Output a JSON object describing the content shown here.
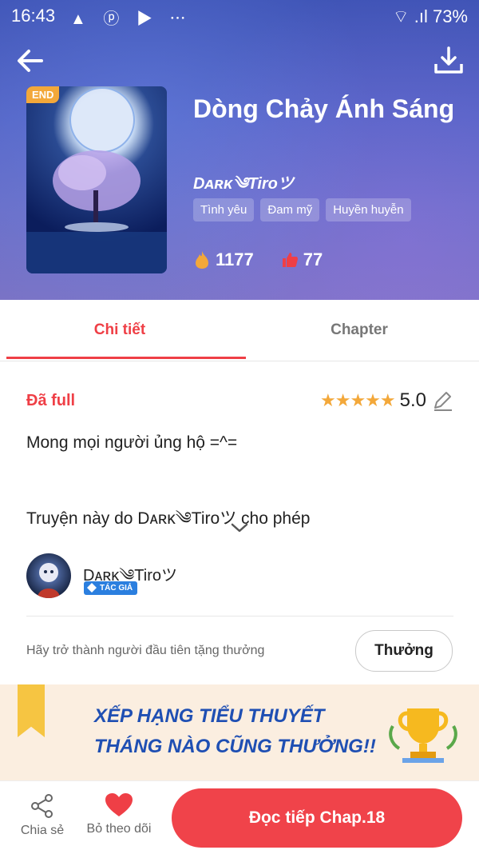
{
  "status_bar": {
    "time": "16:43",
    "notifications": "▲ ⓟ ▶ ⋯",
    "signal": "⌔ .ıl",
    "battery": "73%"
  },
  "book": {
    "badge": "END",
    "title": "Dòng Chảy Ánh Sáng",
    "author": "Dᴀʀᴋ༄Tiroツ",
    "tags": [
      "Tình yêu",
      "Đam mỹ",
      "Huyền huyễn"
    ],
    "views": "1177",
    "likes": "77"
  },
  "tabs": [
    {
      "label": "Chi tiết",
      "active": true
    },
    {
      "label": "Chapter",
      "active": false
    }
  ],
  "details": {
    "status": "Đã full",
    "stars": "★★★★★",
    "rating": "5.0",
    "description_line1": "Mong mọi người ủng hộ =^=",
    "description_line2": "Truyện này do Dᴀʀᴋ༄Tiroツ cho phép"
  },
  "author_card": {
    "name": "Dᴀʀᴋ༄Tiroツ",
    "role_badge": "TÁC GIẢ"
  },
  "gift": {
    "prompt": "Hãy trở thành người đầu tiên tặng thưởng",
    "button": "Thưởng"
  },
  "banner": {
    "line1": "XẾP HẠNG TIỂU THUYẾT",
    "line2": "THÁNG NÀO CŨNG THƯỞNG!!"
  },
  "bottom_bar": {
    "share_label": "Chia sẻ",
    "unfollow_label": "Bỏ theo dõi",
    "read_button": "Đọc tiếp Chap.18"
  },
  "colors": {
    "accent": "#ef3f46",
    "star": "#f3a83a",
    "header_bg": "#4f5fc2"
  }
}
